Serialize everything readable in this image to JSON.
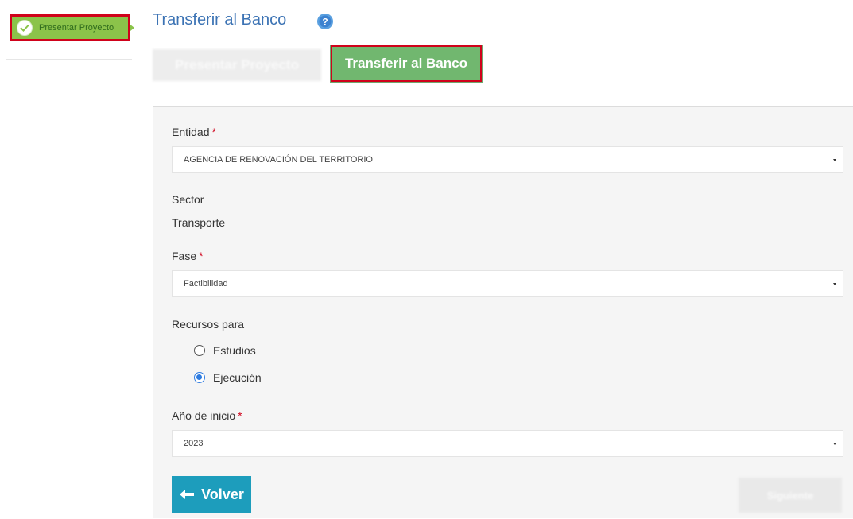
{
  "sidebar": {
    "step_label": "Presentar Proyecto"
  },
  "header": {
    "title": "Transferir al Banco"
  },
  "tabs": [
    {
      "label": "Presentar Proyecto",
      "active": false
    },
    {
      "label": "Transferir al Banco",
      "active": true
    }
  ],
  "form": {
    "entidad": {
      "label": "Entidad",
      "required_mark": "*",
      "value": "AGENCIA DE RENOVACIÓN DEL TERRITORIO"
    },
    "sector": {
      "label": "Sector",
      "value": "Transporte"
    },
    "fase": {
      "label": "Fase",
      "required_mark": "*",
      "value": "Factibilidad"
    },
    "recursos": {
      "label": "Recursos para",
      "options": [
        {
          "label": "Estudios",
          "checked": false
        },
        {
          "label": "Ejecución",
          "checked": true
        }
      ]
    },
    "anio": {
      "label": "Año de inicio",
      "required_mark": "*",
      "value": "2023"
    }
  },
  "buttons": {
    "back_label": "Volver",
    "next_label": "Siguiente"
  },
  "colors": {
    "step_green": "#8bc34a",
    "tab_active_green": "#71b76f",
    "highlight_red": "#d0021b",
    "title_blue": "#3c73b4",
    "back_button_teal": "#1d9dbc",
    "radio_blue": "#2d7be0"
  },
  "icons": {
    "step": "check-icon",
    "help": "help-icon",
    "back": "arrow-left-icon"
  }
}
